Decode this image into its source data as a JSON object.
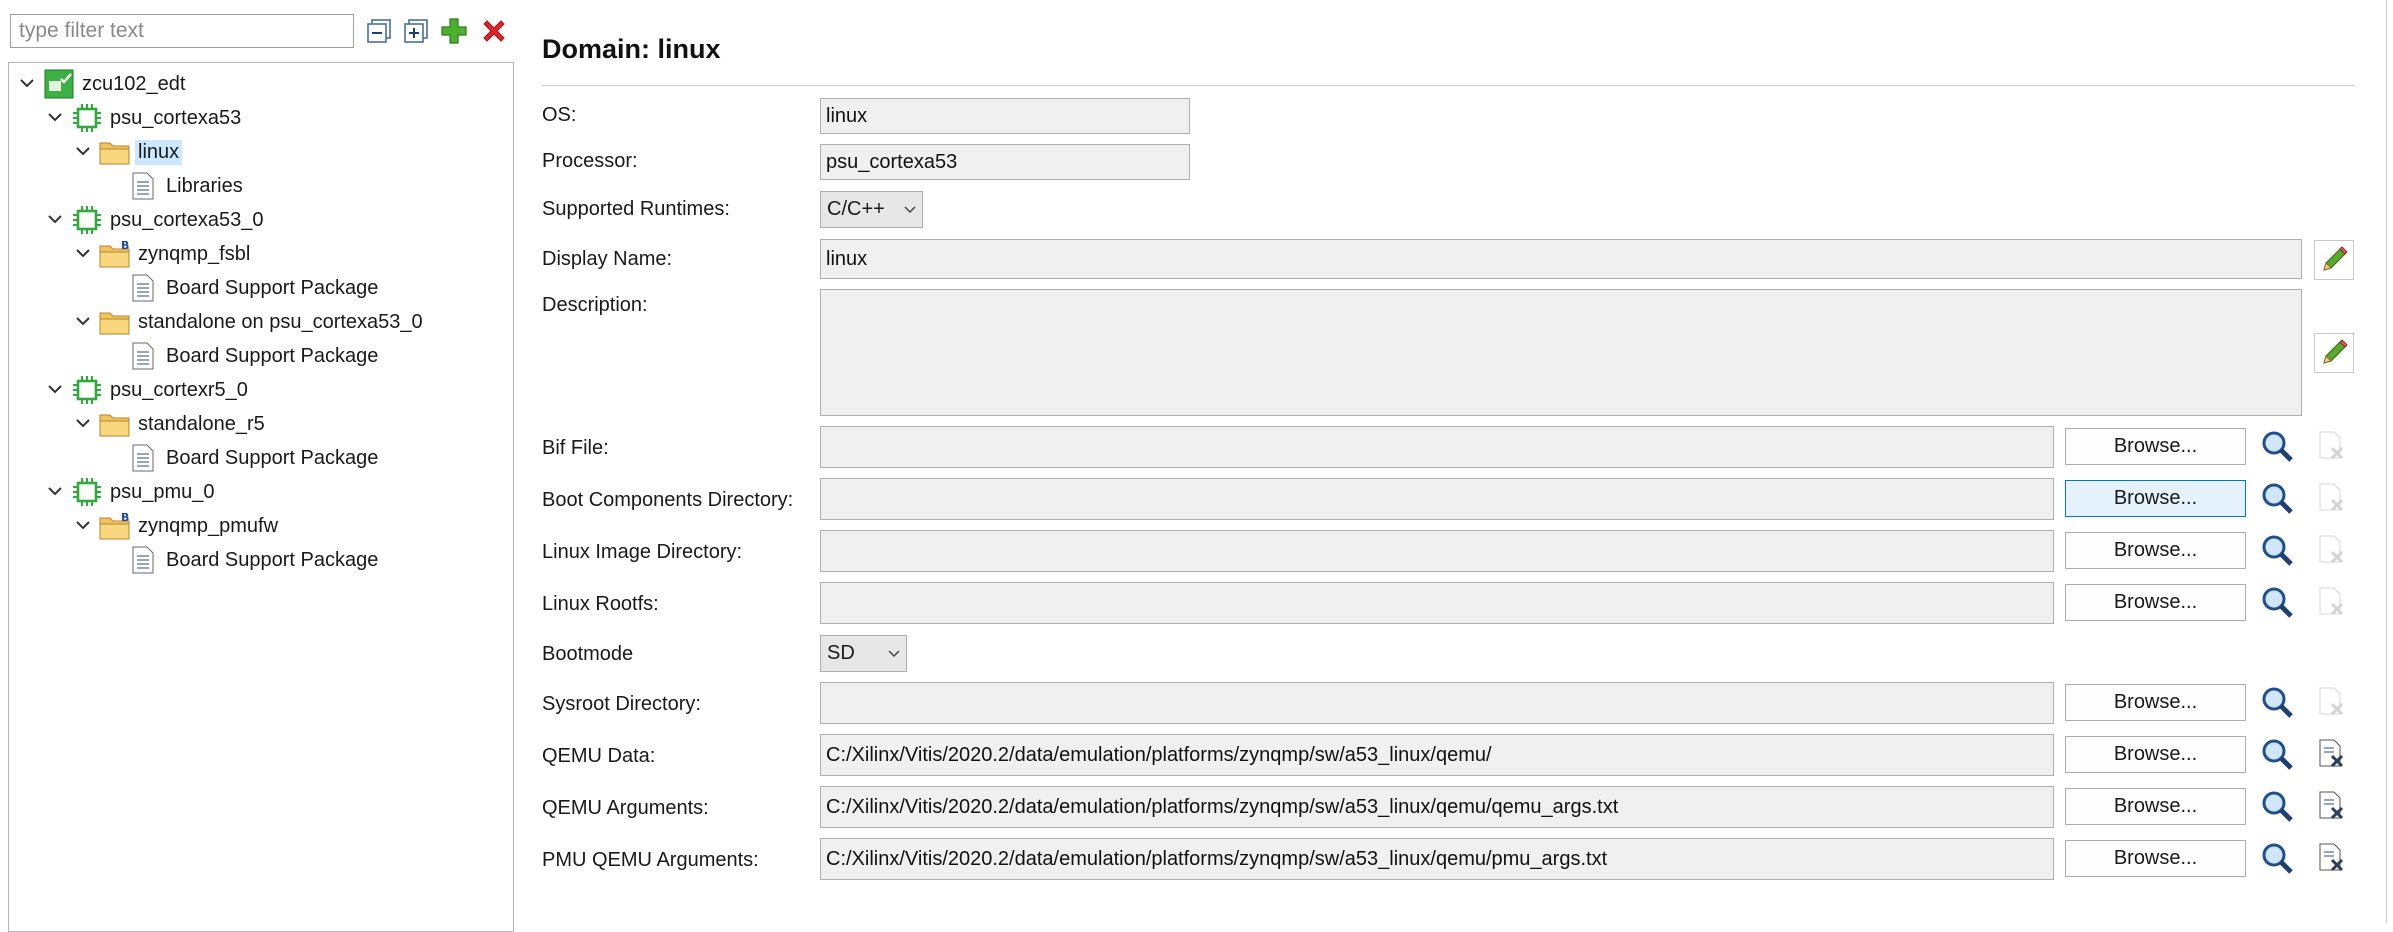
{
  "filter": {
    "placeholder": "type filter text",
    "value": ""
  },
  "toolbar": {
    "collapse_icon": "collapse-all-icon",
    "expand_icon": "expand-all-icon",
    "add_icon": "add-icon",
    "remove_icon": "remove-icon"
  },
  "tree": {
    "platform": "zcu102_edt",
    "proc1": "psu_cortexa53",
    "proc1_domain": "linux",
    "proc1_lib": "Libraries",
    "proc2": "psu_cortexa53_0",
    "proc2_domain1": "zynqmp_fsbl",
    "proc2_domain1_bsp": "Board Support Package",
    "proc2_domain2": "standalone on psu_cortexa53_0",
    "proc2_domain2_bsp": "Board Support Package",
    "proc3": "psu_cortexr5_0",
    "proc3_domain": "standalone_r5",
    "proc3_bsp": "Board Support Package",
    "proc4": "psu_pmu_0",
    "proc4_domain": "zynqmp_pmufw",
    "proc4_bsp": "Board Support Package"
  },
  "domain": {
    "title": "Domain: linux",
    "os_label": "OS:",
    "os_value": "linux",
    "processor_label": "Processor:",
    "processor_value": "psu_cortexa53",
    "runtimes_label": "Supported Runtimes:",
    "runtimes_value": "C/C++",
    "display_name_label": "Display Name:",
    "display_name_value": "linux",
    "description_label": "Description:",
    "description_value": "",
    "bif_label": "Bif File:",
    "bif_value": "",
    "boot_label": "Boot Components Directory:",
    "boot_value": "",
    "image_label": "Linux Image Directory:",
    "image_value": "",
    "rootfs_label": "Linux Rootfs:",
    "rootfs_value": "",
    "bootmode_label": "Bootmode",
    "bootmode_value": "SD",
    "sysroot_label": "Sysroot Directory:",
    "sysroot_value": "",
    "qemu_data_label": "QEMU Data:",
    "qemu_data_value": "C:/Xilinx/Vitis/2020.2/data/emulation/platforms/zynqmp/sw/a53_linux/qemu/",
    "qemu_args_label": "QEMU Arguments:",
    "qemu_args_value": "C:/Xilinx/Vitis/2020.2/data/emulation/platforms/zynqmp/sw/a53_linux/qemu/qemu_args.txt",
    "pmu_args_label": "PMU QEMU Arguments:",
    "pmu_args_value": "C:/Xilinx/Vitis/2020.2/data/emulation/platforms/zynqmp/sw/a53_linux/qemu/pmu_args.txt",
    "browse_label": "Browse..."
  },
  "colors": {
    "selection": "#cce8ff",
    "field_bg": "#f0f0f0",
    "add_green": "#3c9a2a",
    "remove_red": "#d8232a",
    "chip_green": "#3cb043"
  }
}
